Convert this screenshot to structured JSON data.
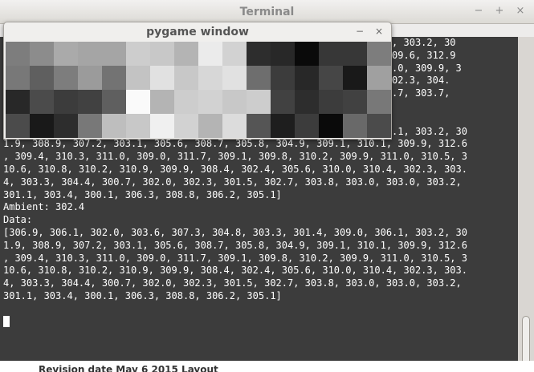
{
  "terminal": {
    "title": "Terminal",
    "controls": {
      "minimize": "−",
      "maximize": "+",
      "close": "×"
    },
    "lines": [
      "",
      "                                                           310.1, 309.6, 312.9",
      "                                                           0.9, 311.0, 309.9, 3",
      "                                                           310.4, 302.3, 304.",
      "                                                           3.0, 302.7, 303.7,",
      "Ambient: 302.4",
      "Data:",
      "[306.9, 306.1, 302.0, 303.6, 307.3, 304.8, 303.3, 301.4, 309.0, 306.1, 303.2, 30",
      "1.9, 308.9, 307.2, 303.1, 305.6, 308.7, 305.8, 304.9, 309.1, 310.1, 309.9, 312.6",
      ", 309.4, 310.3, 311.0, 309.0, 311.7, 309.1, 309.8, 310.2, 309.9, 311.0, 310.5, 3",
      "10.6, 310.8, 310.2, 310.9, 309.9, 308.4, 302.4, 305.6, 310.0, 310.4, 302.3, 303.",
      "4, 303.3, 304.4, 300.7, 302.0, 302.3, 301.5, 302.7, 303.8, 303.0, 303.0, 303.2,",
      "301.1, 303.4, 300.1, 306.3, 308.8, 306.2, 305.1]",
      "Ambient: 302.4",
      "Data:",
      "[306.9, 306.1, 302.0, 303.6, 307.3, 304.8, 303.3, 301.4, 309.0, 306.1, 303.2, 30",
      "1.9, 308.9, 307.2, 303.1, 305.6, 308.7, 305.8, 304.9, 309.1, 310.1, 309.9, 312.6",
      ", 309.4, 310.3, 311.0, 309.0, 311.7, 309.1, 309.8, 310.2, 309.9, 311.0, 310.5, 3",
      "10.6, 310.8, 310.2, 310.9, 309.9, 308.4, 302.4, 305.6, 310.0, 310.4, 302.3, 303.",
      "4, 303.3, 304.4, 300.7, 302.0, 302.3, 301.5, 302.7, 303.8, 303.0, 303.0, 303.2,",
      "301.1, 303.4, 300.1, 306.3, 308.8, 306.2, 305.1]"
    ],
    "hidden_first_line": "                                                           0, 305.3, 303.2, 30",
    "colors": {
      "background": "#3c3c3c",
      "text": "#ffffff"
    }
  },
  "pygame": {
    "title": "pygame window",
    "controls": {
      "minimize": "−",
      "close": "×"
    },
    "grid": {
      "rows": 4,
      "cols": 16,
      "gray_levels": [
        [
          125,
          140,
          170,
          165,
          165,
          205,
          200,
          180,
          235,
          210,
          45,
          40,
          10,
          55,
          55,
          125
        ],
        [
          120,
          95,
          125,
          155,
          115,
          195,
          225,
          200,
          215,
          225,
          110,
          60,
          40,
          70,
          25,
          160
        ],
        [
          40,
          75,
          60,
          65,
          95,
          250,
          180,
          205,
          210,
          200,
          205,
          65,
          45,
          60,
          65,
          120
        ],
        [
          75,
          25,
          45,
          120,
          190,
          200,
          240,
          210,
          180,
          220,
          85,
          30,
          60,
          10,
          105,
          75
        ]
      ]
    }
  },
  "background_window": {
    "text": "Revision date  May 6  2015  Layout"
  }
}
